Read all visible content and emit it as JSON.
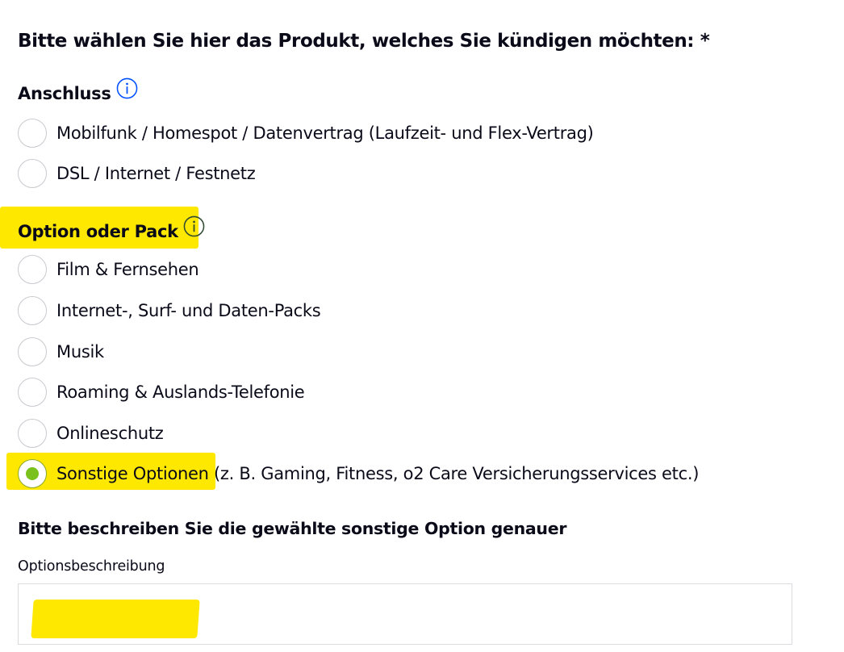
{
  "question": "Bitte wählen Sie hier das Produkt, welches Sie kündigen möchten: *",
  "groups": [
    {
      "title": "Anschluss",
      "info_icon": "info-icon",
      "options": [
        {
          "label": "Mobilfunk / Homespot / Datenvertrag (Laufzeit- und Flex-Vertrag)",
          "checked": false
        },
        {
          "label": "DSL / Internet / Festnetz",
          "checked": false
        }
      ]
    },
    {
      "title": "Option oder Pack",
      "info_icon": "info-icon",
      "options": [
        {
          "label": "Film & Fernsehen",
          "checked": false
        },
        {
          "label": "Internet-, Surf- und Daten-Packs",
          "checked": false
        },
        {
          "label": "Musik",
          "checked": false
        },
        {
          "label": "Roaming & Auslands-Telefonie",
          "checked": false
        },
        {
          "label": "Onlineschutz",
          "checked": false
        },
        {
          "label": "Sonstige Optionen",
          "label_suffix": " (z. B. Gaming, Fitness, o2 Care Versicherungsservices etc.)",
          "checked": true
        }
      ]
    }
  ],
  "details": {
    "heading": "Bitte beschreiben Sie die gewählte sonstige Option genauer",
    "field_label": "Optionsbeschreibung",
    "field_value": ""
  },
  "colors": {
    "text": "#0a0a19",
    "info_icon": "#0050ff",
    "radio_checked": "#7ac11e",
    "highlight": "#ffe800"
  }
}
